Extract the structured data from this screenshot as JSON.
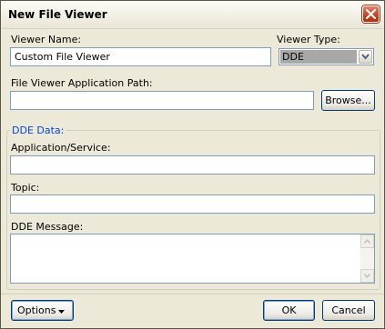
{
  "window": {
    "title": "New File Viewer"
  },
  "viewer_name": {
    "label": "Viewer Name:",
    "value": "Custom File Viewer"
  },
  "viewer_type": {
    "label": "Viewer Type:",
    "selected": "DDE"
  },
  "app_path": {
    "label": "File Viewer Application Path:",
    "value": "",
    "browse_label": "Browse..."
  },
  "dde": {
    "group_title": "DDE Data:",
    "application_label": "Application/Service:",
    "application_value": "",
    "topic_label": "Topic:",
    "topic_value": "",
    "message_label": "DDE Message:",
    "message_value": ""
  },
  "footer": {
    "options_label": "Options",
    "ok_label": "OK",
    "cancel_label": "Cancel"
  },
  "icons": {
    "close": "close-icon",
    "dropdown": "chevron-down-icon",
    "scroll_up": "scroll-up-icon",
    "scroll_down": "scroll-down-icon"
  }
}
